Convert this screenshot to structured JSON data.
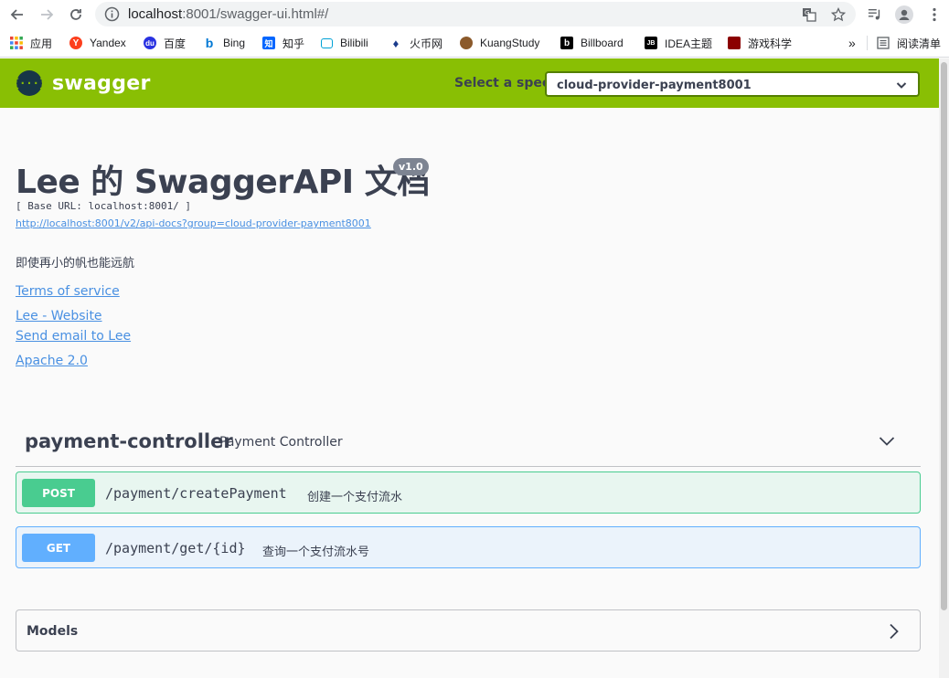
{
  "browser": {
    "url_host": "localhost",
    "url_rest": ":8001/swagger-ui.html#/",
    "bookmarks": [
      {
        "label": "应用",
        "icon": "apps-grid-icon"
      },
      {
        "label": "Yandex",
        "icon": "yandex-icon"
      },
      {
        "label": "百度",
        "icon": "baidu-icon"
      },
      {
        "label": "Bing",
        "icon": "bing-icon"
      },
      {
        "label": "知乎",
        "icon": "zhihu-icon"
      },
      {
        "label": "Bilibili",
        "icon": "bilibili-icon"
      },
      {
        "label": "火币网",
        "icon": "huobi-icon"
      },
      {
        "label": "KuangStudy",
        "icon": "kuangstudy-icon"
      },
      {
        "label": "Billboard",
        "icon": "billboard-icon"
      },
      {
        "label": "IDEA主题",
        "icon": "jetbrains-icon"
      },
      {
        "label": "游戏科学",
        "icon": "game-science-icon"
      }
    ],
    "overflow_label": "»",
    "reading_list_label": "阅读清单"
  },
  "swagger": {
    "logo_mark": "{···}",
    "logo_text": "swagger",
    "spec_label": "Select a spec",
    "spec_selected": "cloud-provider-payment8001"
  },
  "info": {
    "title": "Lee 的 SwaggerAPI 文档",
    "version": "v1.0",
    "base_url": "[ Base URL: localhost:8001/ ]",
    "api_docs_link": "http://localhost:8001/v2/api-docs?group=cloud-provider-payment8001",
    "description": "即使再小的帆也能远航",
    "terms": "Terms of service",
    "website": "Lee - Website",
    "email": "Send email to Lee",
    "license": "Apache 2.0"
  },
  "controller": {
    "name": "payment-controller",
    "description": "Payment Controller",
    "operations": [
      {
        "method": "POST",
        "path": "/payment/createPayment",
        "summary": "创建一个支付流水"
      },
      {
        "method": "GET",
        "path": "/payment/get/{id}",
        "summary": "查询一个支付流水号"
      }
    ]
  },
  "models": {
    "title": "Models"
  },
  "colors": {
    "header": "#89bf04",
    "post": "#49cc90",
    "get": "#61affe",
    "link": "#4990e2"
  }
}
